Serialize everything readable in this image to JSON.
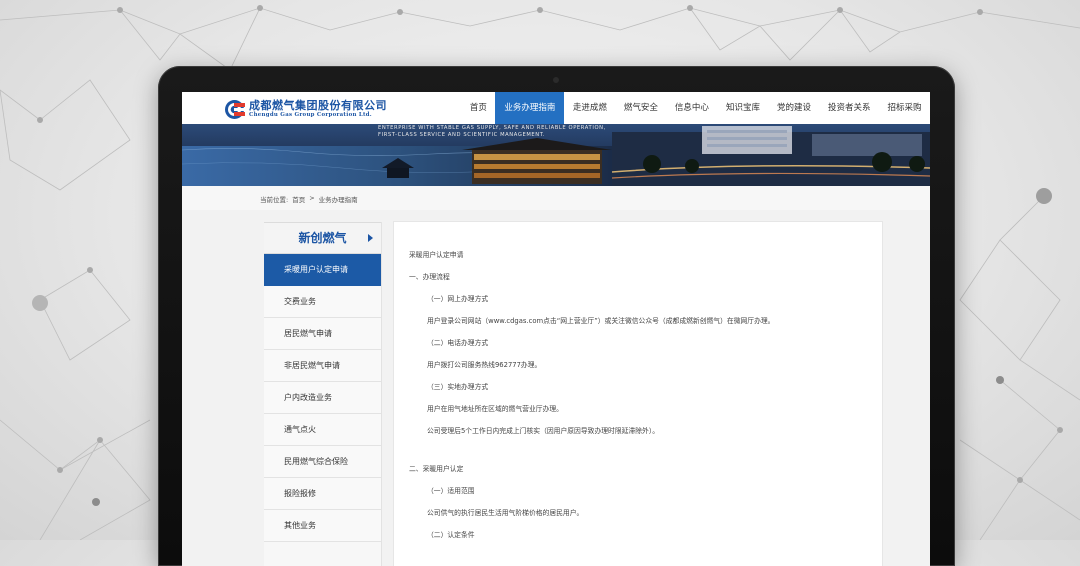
{
  "header": {
    "logo_cn": "成都燃气集团股份有限公司",
    "logo_en": "Chengdu Gas Group Corporation Ltd.",
    "nav": [
      "首页",
      "业务办理指南",
      "走进成燃",
      "燃气安全",
      "信息中心",
      "知识宝库",
      "党的建设",
      "投资者关系",
      "招标采购"
    ],
    "active_nav": "业务办理指南"
  },
  "banner": {
    "slogan_line1": "ENTERPRISE WITH STABLE GAS SUPPLY, SAFE AND RELIABLE OPERATION,",
    "slogan_line2": "FIRST-CLASS SERVICE AND SCIENTIFIC MANAGEMENT."
  },
  "breadcrumb": {
    "label": "当前位置:",
    "home": "首页",
    "separator": ">",
    "current": "业务办理指南"
  },
  "sidebar": {
    "title": "新创燃气",
    "items": [
      {
        "label": "采暖用户认定申请",
        "active": true
      },
      {
        "label": "交费业务",
        "active": false
      },
      {
        "label": "居民燃气申请",
        "active": false
      },
      {
        "label": "非居民燃气申请",
        "active": false
      },
      {
        "label": "户内改造业务",
        "active": false
      },
      {
        "label": "通气点火",
        "active": false
      },
      {
        "label": "民用燃气综合保险",
        "active": false
      },
      {
        "label": "报险报修",
        "active": false
      },
      {
        "label": "其他业务",
        "active": false
      }
    ]
  },
  "article": {
    "lines": [
      "采暖用户认定申请",
      "一、办理流程",
      "（一）网上办理方式",
      "用户登录公司网站（www.cdgas.com点击“网上营业厅”）或关注微信公众号（成都成燃新创燃气）在微网厅办理。",
      "（二）电话办理方式",
      "用户拨打公司服务热线962777办理。",
      "（三）实地办理方式",
      "用户在用气地址所在区域的燃气营业厅办理。",
      "公司受理后5个工作日内完成上门核实（因用户原因导致办理时限延滞除外）。",
      "二、采暖用户认定",
      "（一）适用范围",
      "公司供气的执行居民生活用气阶梯价格的居民用户。",
      "（二）认定条件"
    ]
  },
  "colors": {
    "brand_blue": "#1c55a4",
    "nav_active": "#2470c2",
    "sidebar_active": "#1c5aa6"
  }
}
